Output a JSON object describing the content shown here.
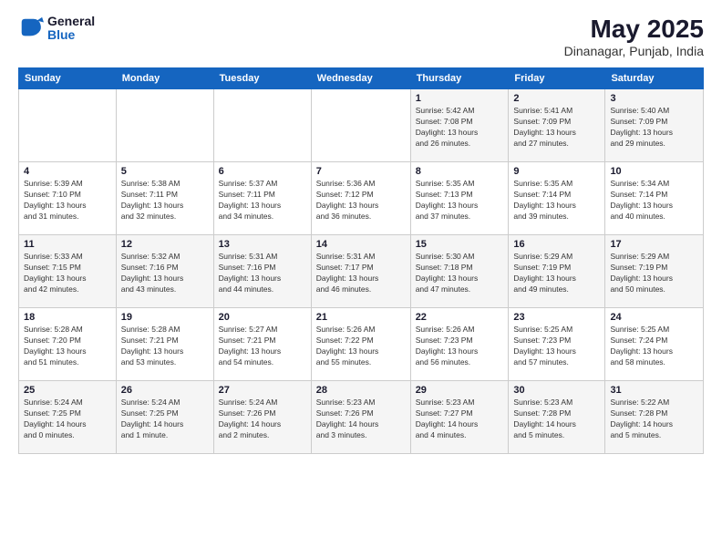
{
  "logo": {
    "line1": "General",
    "line2": "Blue"
  },
  "title": "May 2025",
  "subtitle": "Dinanagar, Punjab, India",
  "weekdays": [
    "Sunday",
    "Monday",
    "Tuesday",
    "Wednesday",
    "Thursday",
    "Friday",
    "Saturday"
  ],
  "weeks": [
    [
      {
        "day": "",
        "info": ""
      },
      {
        "day": "",
        "info": ""
      },
      {
        "day": "",
        "info": ""
      },
      {
        "day": "",
        "info": ""
      },
      {
        "day": "1",
        "info": "Sunrise: 5:42 AM\nSunset: 7:08 PM\nDaylight: 13 hours\nand 26 minutes."
      },
      {
        "day": "2",
        "info": "Sunrise: 5:41 AM\nSunset: 7:09 PM\nDaylight: 13 hours\nand 27 minutes."
      },
      {
        "day": "3",
        "info": "Sunrise: 5:40 AM\nSunset: 7:09 PM\nDaylight: 13 hours\nand 29 minutes."
      }
    ],
    [
      {
        "day": "4",
        "info": "Sunrise: 5:39 AM\nSunset: 7:10 PM\nDaylight: 13 hours\nand 31 minutes."
      },
      {
        "day": "5",
        "info": "Sunrise: 5:38 AM\nSunset: 7:11 PM\nDaylight: 13 hours\nand 32 minutes."
      },
      {
        "day": "6",
        "info": "Sunrise: 5:37 AM\nSunset: 7:11 PM\nDaylight: 13 hours\nand 34 minutes."
      },
      {
        "day": "7",
        "info": "Sunrise: 5:36 AM\nSunset: 7:12 PM\nDaylight: 13 hours\nand 36 minutes."
      },
      {
        "day": "8",
        "info": "Sunrise: 5:35 AM\nSunset: 7:13 PM\nDaylight: 13 hours\nand 37 minutes."
      },
      {
        "day": "9",
        "info": "Sunrise: 5:35 AM\nSunset: 7:14 PM\nDaylight: 13 hours\nand 39 minutes."
      },
      {
        "day": "10",
        "info": "Sunrise: 5:34 AM\nSunset: 7:14 PM\nDaylight: 13 hours\nand 40 minutes."
      }
    ],
    [
      {
        "day": "11",
        "info": "Sunrise: 5:33 AM\nSunset: 7:15 PM\nDaylight: 13 hours\nand 42 minutes."
      },
      {
        "day": "12",
        "info": "Sunrise: 5:32 AM\nSunset: 7:16 PM\nDaylight: 13 hours\nand 43 minutes."
      },
      {
        "day": "13",
        "info": "Sunrise: 5:31 AM\nSunset: 7:16 PM\nDaylight: 13 hours\nand 44 minutes."
      },
      {
        "day": "14",
        "info": "Sunrise: 5:31 AM\nSunset: 7:17 PM\nDaylight: 13 hours\nand 46 minutes."
      },
      {
        "day": "15",
        "info": "Sunrise: 5:30 AM\nSunset: 7:18 PM\nDaylight: 13 hours\nand 47 minutes."
      },
      {
        "day": "16",
        "info": "Sunrise: 5:29 AM\nSunset: 7:19 PM\nDaylight: 13 hours\nand 49 minutes."
      },
      {
        "day": "17",
        "info": "Sunrise: 5:29 AM\nSunset: 7:19 PM\nDaylight: 13 hours\nand 50 minutes."
      }
    ],
    [
      {
        "day": "18",
        "info": "Sunrise: 5:28 AM\nSunset: 7:20 PM\nDaylight: 13 hours\nand 51 minutes."
      },
      {
        "day": "19",
        "info": "Sunrise: 5:28 AM\nSunset: 7:21 PM\nDaylight: 13 hours\nand 53 minutes."
      },
      {
        "day": "20",
        "info": "Sunrise: 5:27 AM\nSunset: 7:21 PM\nDaylight: 13 hours\nand 54 minutes."
      },
      {
        "day": "21",
        "info": "Sunrise: 5:26 AM\nSunset: 7:22 PM\nDaylight: 13 hours\nand 55 minutes."
      },
      {
        "day": "22",
        "info": "Sunrise: 5:26 AM\nSunset: 7:23 PM\nDaylight: 13 hours\nand 56 minutes."
      },
      {
        "day": "23",
        "info": "Sunrise: 5:25 AM\nSunset: 7:23 PM\nDaylight: 13 hours\nand 57 minutes."
      },
      {
        "day": "24",
        "info": "Sunrise: 5:25 AM\nSunset: 7:24 PM\nDaylight: 13 hours\nand 58 minutes."
      }
    ],
    [
      {
        "day": "25",
        "info": "Sunrise: 5:24 AM\nSunset: 7:25 PM\nDaylight: 14 hours\nand 0 minutes."
      },
      {
        "day": "26",
        "info": "Sunrise: 5:24 AM\nSunset: 7:25 PM\nDaylight: 14 hours\nand 1 minute."
      },
      {
        "day": "27",
        "info": "Sunrise: 5:24 AM\nSunset: 7:26 PM\nDaylight: 14 hours\nand 2 minutes."
      },
      {
        "day": "28",
        "info": "Sunrise: 5:23 AM\nSunset: 7:26 PM\nDaylight: 14 hours\nand 3 minutes."
      },
      {
        "day": "29",
        "info": "Sunrise: 5:23 AM\nSunset: 7:27 PM\nDaylight: 14 hours\nand 4 minutes."
      },
      {
        "day": "30",
        "info": "Sunrise: 5:23 AM\nSunset: 7:28 PM\nDaylight: 14 hours\nand 5 minutes."
      },
      {
        "day": "31",
        "info": "Sunrise: 5:22 AM\nSunset: 7:28 PM\nDaylight: 14 hours\nand 5 minutes."
      }
    ]
  ]
}
